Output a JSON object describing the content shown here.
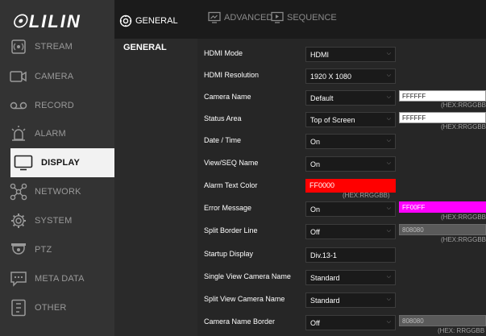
{
  "brand": {
    "logo_text": "LILIN"
  },
  "sidebar": {
    "items": [
      {
        "label": "STREAM",
        "icon": "stream-icon"
      },
      {
        "label": "CAMERA",
        "icon": "camera-icon"
      },
      {
        "label": "RECORD",
        "icon": "record-icon"
      },
      {
        "label": "ALARM",
        "icon": "alarm-icon"
      },
      {
        "label": "DISPLAY",
        "icon": "display-icon",
        "active": true
      },
      {
        "label": "NETWORK",
        "icon": "network-icon"
      },
      {
        "label": "SYSTEM",
        "icon": "gear-icon"
      },
      {
        "label": "PTZ",
        "icon": "ptz-icon"
      },
      {
        "label": "META DATA",
        "icon": "metadata-icon"
      },
      {
        "label": "OTHER",
        "icon": "other-icon"
      }
    ]
  },
  "submenu": {
    "tab_label": "GENERAL",
    "item_label": "GENERAL"
  },
  "tabs": {
    "advanced": "ADVANCED",
    "sequence": "SEQUENCE"
  },
  "form": {
    "hdmi_mode": {
      "label": "HDMI Mode",
      "value": "HDMI"
    },
    "hdmi_resolution": {
      "label": "HDMI Resolution",
      "value": "1920 X 1080"
    },
    "camera_name": {
      "label": "Camera Name",
      "value": "Default",
      "hex": "FFFFFF",
      "hint": "(HEX:RRGGBB"
    },
    "status_area": {
      "label": "Status Area",
      "value": "Top of Screen",
      "hex": "FFFFFF",
      "hint": "(HEX:RRGGBB"
    },
    "date_time": {
      "label": "Date / Time",
      "value": "On"
    },
    "view_seq_name": {
      "label": "View/SEQ Name",
      "value": "On"
    },
    "alarm_text_color": {
      "label": "Alarm Text Color",
      "value": "FF0000",
      "hint": "(HEX:RRGGBB)"
    },
    "error_message": {
      "label": "Error Message",
      "value": "On",
      "hex": "FF00FF",
      "hint": "(HEX:RRGGBB"
    },
    "split_border_line": {
      "label": "Split Border Line",
      "value": "Off",
      "hex": "808080",
      "hint": "(HEX:RRGGBB"
    },
    "startup_display": {
      "label": "Startup Display",
      "value": "Div.13-1"
    },
    "single_view_camera_name": {
      "label": "Single View Camera Name",
      "value": "Standard"
    },
    "split_view_camera_name": {
      "label": "Split View Camera Name",
      "value": "Standard"
    },
    "camera_name_border": {
      "label": "Camera Name Border",
      "value": "Off",
      "hex": "808080",
      "hint": "(HEX: RRGGBB"
    }
  },
  "colors": {
    "alarm_swatch": "#ff0000",
    "error_swatch": "#ff00ff"
  }
}
